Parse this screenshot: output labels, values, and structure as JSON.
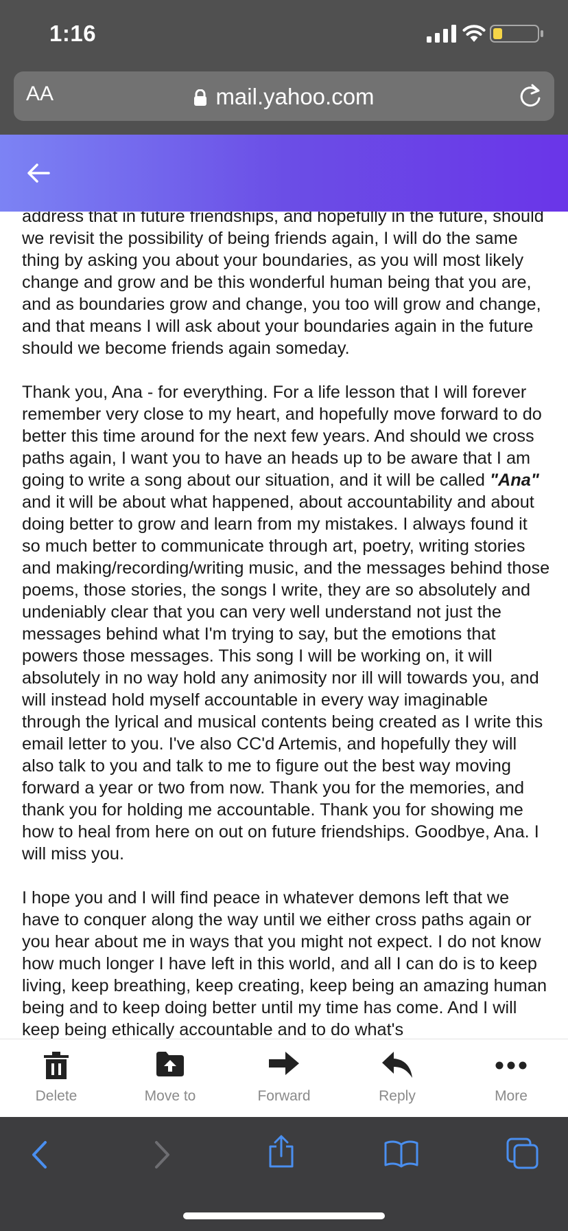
{
  "status_bar": {
    "time": "1:16"
  },
  "browser": {
    "text_size_button": "AA",
    "url": "mail.yahoo.com"
  },
  "colors": {
    "header_gradient_start": "#7c83f4",
    "header_gradient_end": "#6a35e8",
    "safari_icon_blue": "#4a8ff0"
  },
  "email": {
    "paragraphs": [
      {
        "text": "address that in future friendships, and hopefully in the future, should we revisit the possibility of being friends again, I will do the same thing by asking you about your boundaries, as you will most likely change and grow and be this wonderful human being that you are, and as boundaries grow and change, you too will grow and change, and that means I will ask about your boundaries again in the future should we become friends again someday."
      },
      {
        "before": "Thank you, Ana - for everything. For a life lesson that I will forever remember very close to my heart, and hopefully move forward to do better this time around for the next few years. And should we cross paths again, I want you to have an heads up to be aware that I am going to write a song about our situation, and it will be called ",
        "song_title": "\"Ana\"",
        "after": " and it will be about what happened, about accountability and about doing better to grow and learn from my mistakes. I always found it so much better to communicate through art, poetry, writing stories and making/recording/writing music, and the messages behind those poems, those stories, the songs I write, they are so absolutely and undeniably clear that you can very well understand not just the messages behind what I'm trying to say, but the emotions that powers those messages. This song I will be working on, it will absolutely in no way hold any animosity nor ill will towards you, and will instead hold myself accountable in every way imaginable through the lyrical and musical contents being created as I write this email letter to you. I've also CC'd Artemis, and hopefully they will also talk to you and talk to me to figure out the best way moving forward a year or two from now. Thank you for the memories, and thank you for holding me accountable. Thank you for showing me how to heal from here on out on future friendships. Goodbye, Ana. I will miss you."
      },
      {
        "text": "I hope you and I will find peace in whatever demons left that we have to conquer along the way until we either cross paths again or you hear about me in ways that you might not expect. I do not know how much longer I have left in this world, and all I can do is to keep living, keep breathing, keep creating, keep being an amazing human being and to keep doing better until my time has come. And I will keep being ethically accountable and to do what's"
      }
    ]
  },
  "toolbar": {
    "actions": [
      {
        "label": "Delete",
        "icon": "trash-icon"
      },
      {
        "label": "Move to",
        "icon": "move-to-folder-icon"
      },
      {
        "label": "Forward",
        "icon": "forward-arrow-icon"
      },
      {
        "label": "Reply",
        "icon": "reply-arrow-icon"
      },
      {
        "label": "More",
        "icon": "more-dots-icon"
      }
    ]
  },
  "safari_bar": {
    "icons": [
      "back-chevron-icon",
      "forward-chevron-icon",
      "share-icon",
      "bookmarks-icon",
      "tabs-icon"
    ]
  }
}
